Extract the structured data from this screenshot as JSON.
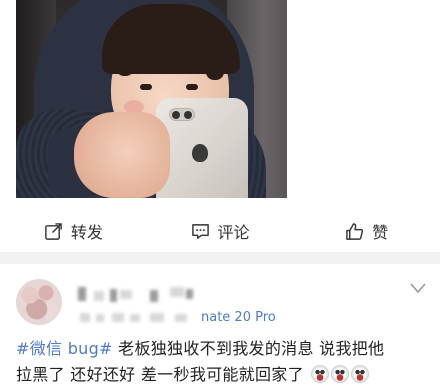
{
  "actions": {
    "repost_label": "转发",
    "comment_label": "评论",
    "like_label": "赞"
  },
  "comment": {
    "device": "nate 20 Pro",
    "hashtag": "#微信 bug#",
    "text_line1": " 老板独独收不到我发的消息   说我把他",
    "text_line2": "拉黑了   还好还好 差一秒我可能就回家了",
    "emojis": [
      "laughing-cry-emoji",
      "laughing-cry-emoji",
      "laughing-cry-emoji"
    ]
  },
  "colors": {
    "link": "#4f7cc3",
    "divider": "#f2f2f2"
  }
}
